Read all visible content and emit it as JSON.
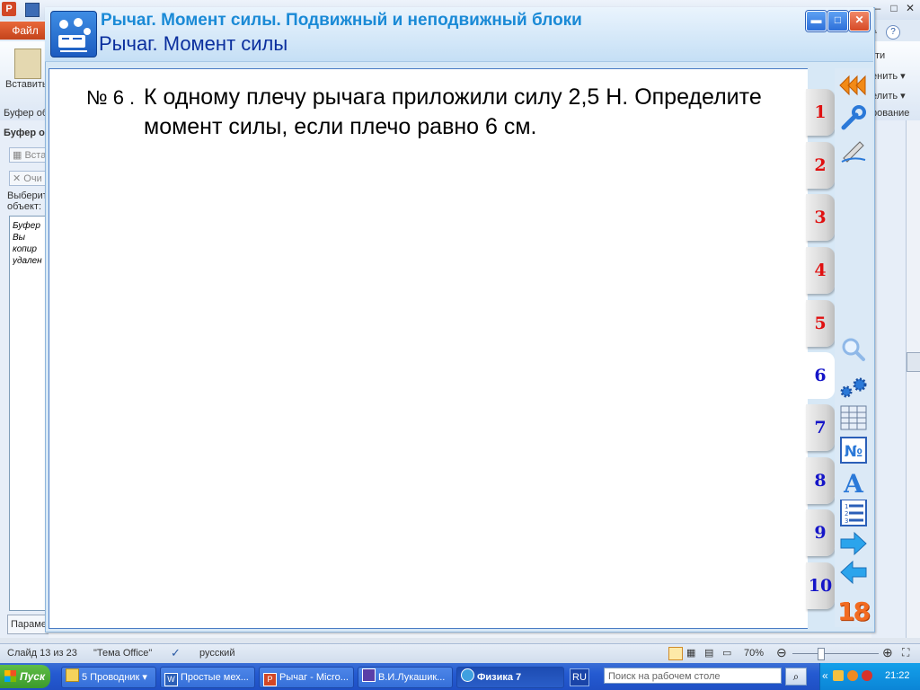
{
  "background_app": {
    "file_tab": "Файл",
    "paste_label": "Вставить",
    "clipboard_group": "Буфер об",
    "right_ribbon_texts": [
      "ти",
      "енить ▾",
      "елить ▾",
      "рование"
    ],
    "pane_title": "Буфер о",
    "pane_btn_insert": "Вста",
    "pane_btn_clear": "Очи",
    "pane_select_text": "Выберит объект:",
    "pane_list_text": "Буфер\nВы\nкопир\nудален",
    "pane_params_button": "Парамет"
  },
  "app": {
    "title_line1": "Рычаг. Момент силы. Подвижный и неподвижный блоки",
    "title_line2": "Рычаг. Момент силы"
  },
  "task": {
    "number": "№ 6 .",
    "text": "К одному плечу рычага приложили силу 2,5 Н. Определите момент силы, если плечо равно 6 см."
  },
  "task_tabs": [
    {
      "label": "1",
      "color": "#e01010"
    },
    {
      "label": "2",
      "color": "#e01010"
    },
    {
      "label": "3",
      "color": "#e01010"
    },
    {
      "label": "4",
      "color": "#e01010"
    },
    {
      "label": "5",
      "color": "#e01010"
    },
    {
      "label": "6",
      "color": "#1515c8",
      "selected": true
    },
    {
      "label": "7",
      "color": "#1515c8"
    },
    {
      "label": "8",
      "color": "#1515c8"
    },
    {
      "label": "9",
      "color": "#1515c8"
    },
    {
      "label": "10",
      "color": "#1515c8"
    }
  ],
  "toolbar": {
    "icons": [
      "rewind-icon",
      "wrench-icon",
      "pencil-icon",
      "zoom-icon",
      "gears-icon",
      "table-icon",
      "number-sign-icon",
      "font-icon",
      "numbered-list-icon",
      "forward-arrow-icon",
      "back-arrow-icon"
    ],
    "number_badge": "18"
  },
  "statusbar": {
    "slide": "Слайд 13 из 23",
    "theme": "\"Тема Office\"",
    "language": "русский",
    "zoom": "70%"
  },
  "taskbar": {
    "start": "Пуск",
    "items": [
      "5 Проводник",
      "Простые мех...",
      "Рычаг - Micro...",
      "В.И.Лукашик...",
      "Физика 7"
    ],
    "lang": "RU",
    "search_placeholder": "Поиск на рабочем столе",
    "time": "21:22"
  }
}
